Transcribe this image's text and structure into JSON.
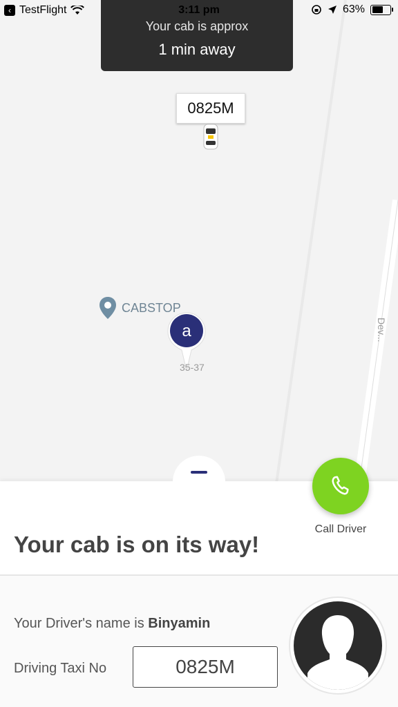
{
  "status_bar": {
    "back_app": "TestFlight",
    "time": "3:11 pm",
    "battery": "63%",
    "battery_level": 0.63
  },
  "toast": {
    "line1": "Your cab is approx",
    "line2": "1 min away"
  },
  "map": {
    "cab_plate_label": "0825M",
    "poi_label": "CABSTOP",
    "pickup_marker_letter": "a",
    "address_number": "35-37",
    "road_label": "Dev..."
  },
  "actions": {
    "call_driver_label": "Call Driver"
  },
  "trip": {
    "headline": "Your cab is on its way!",
    "driver_prefix": "Your Driver's name is",
    "driver_name": "Binyamin",
    "taxi_label": "Driving Taxi No",
    "taxi_number": "0825M"
  },
  "colors": {
    "accent_green": "#7ed321",
    "marker_navy": "#2a2f78",
    "toast_bg": "#2d2d2d"
  }
}
